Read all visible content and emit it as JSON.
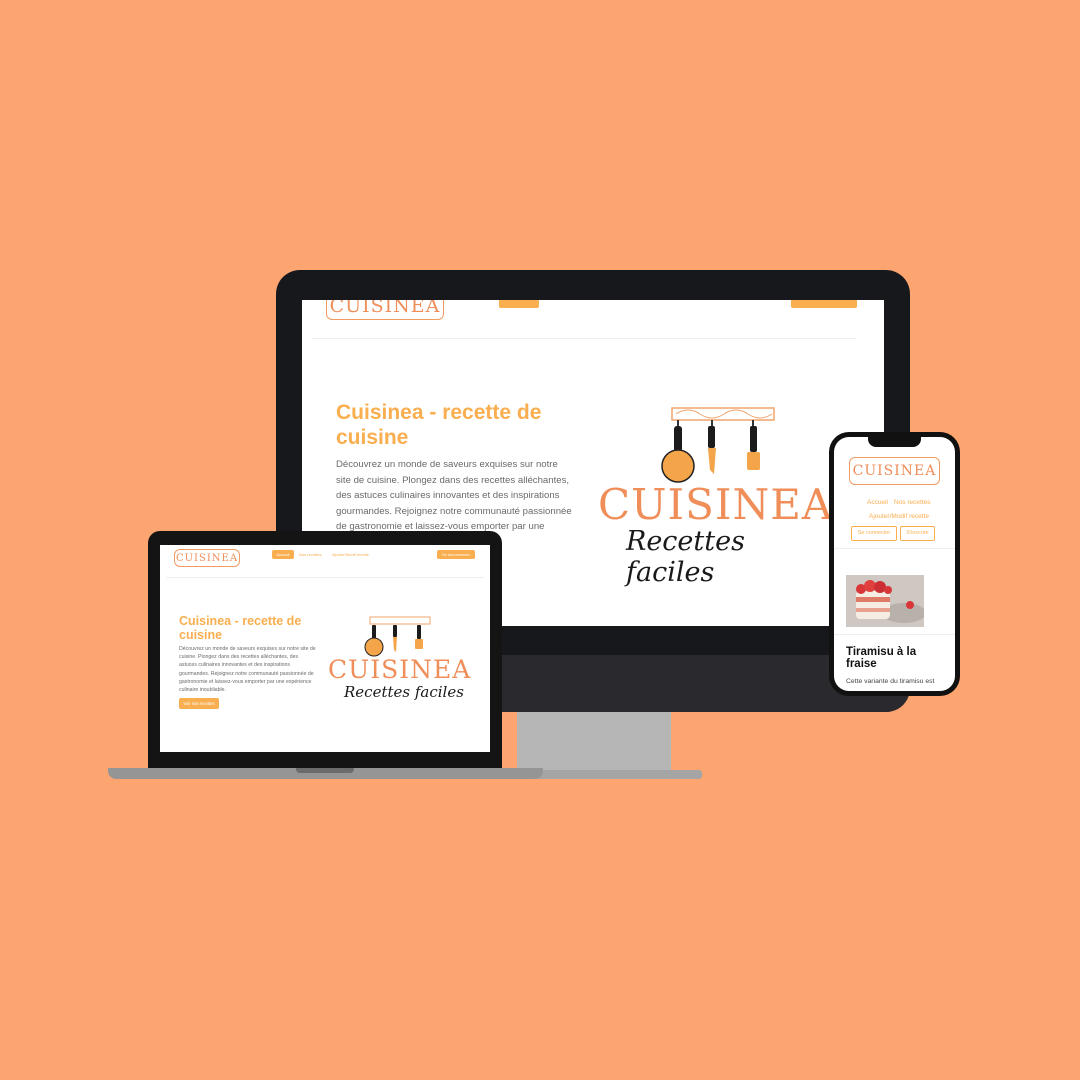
{
  "brand": {
    "logo_text": "CUISINEA",
    "tagline": "Recettes faciles"
  },
  "desktop": {
    "hero_title": "Cuisinea - recette de cuisine",
    "hero_text": "Découvrez un monde de saveurs exquises sur notre site de cuisine. Plongez dans des recettes alléchantes, des astuces culinaires innovantes et des inspirations gourmandes. Rejoignez notre communauté passionnée de gastronomie et laissez-vous emporter par une"
  },
  "laptop": {
    "nav": {
      "home": "Accueil",
      "recipes": "Nos recettes",
      "add": "Ajouter/Modif recette",
      "logout": "Se déconnecter"
    },
    "hero_title": "Cuisinea - recette de cuisine",
    "hero_text": "Découvrez un monde de saveurs exquises sur notre site de cuisine. Plongez dans des recettes alléchantes, des astuces culinaires innovantes et des inspirations gourmandes. Rejoignez notre communauté passionnée de gastronomie et laissez-vous emporter par une expérience culinaire inoubliable.",
    "cta": "Voir nos recettes"
  },
  "phone": {
    "nav": {
      "home": "Accueil",
      "recipes": "Nos recettes",
      "add": "Ajouter/Modif recette"
    },
    "login": "Se connecter",
    "signup": "S'inscrire",
    "card_title": "Tiramisu à la fraise",
    "card_text": "Cette variante du tiramisu est"
  },
  "colors": {
    "background": "#fda571",
    "accent": "#f9ae4f",
    "logo": "#ef8e59"
  }
}
